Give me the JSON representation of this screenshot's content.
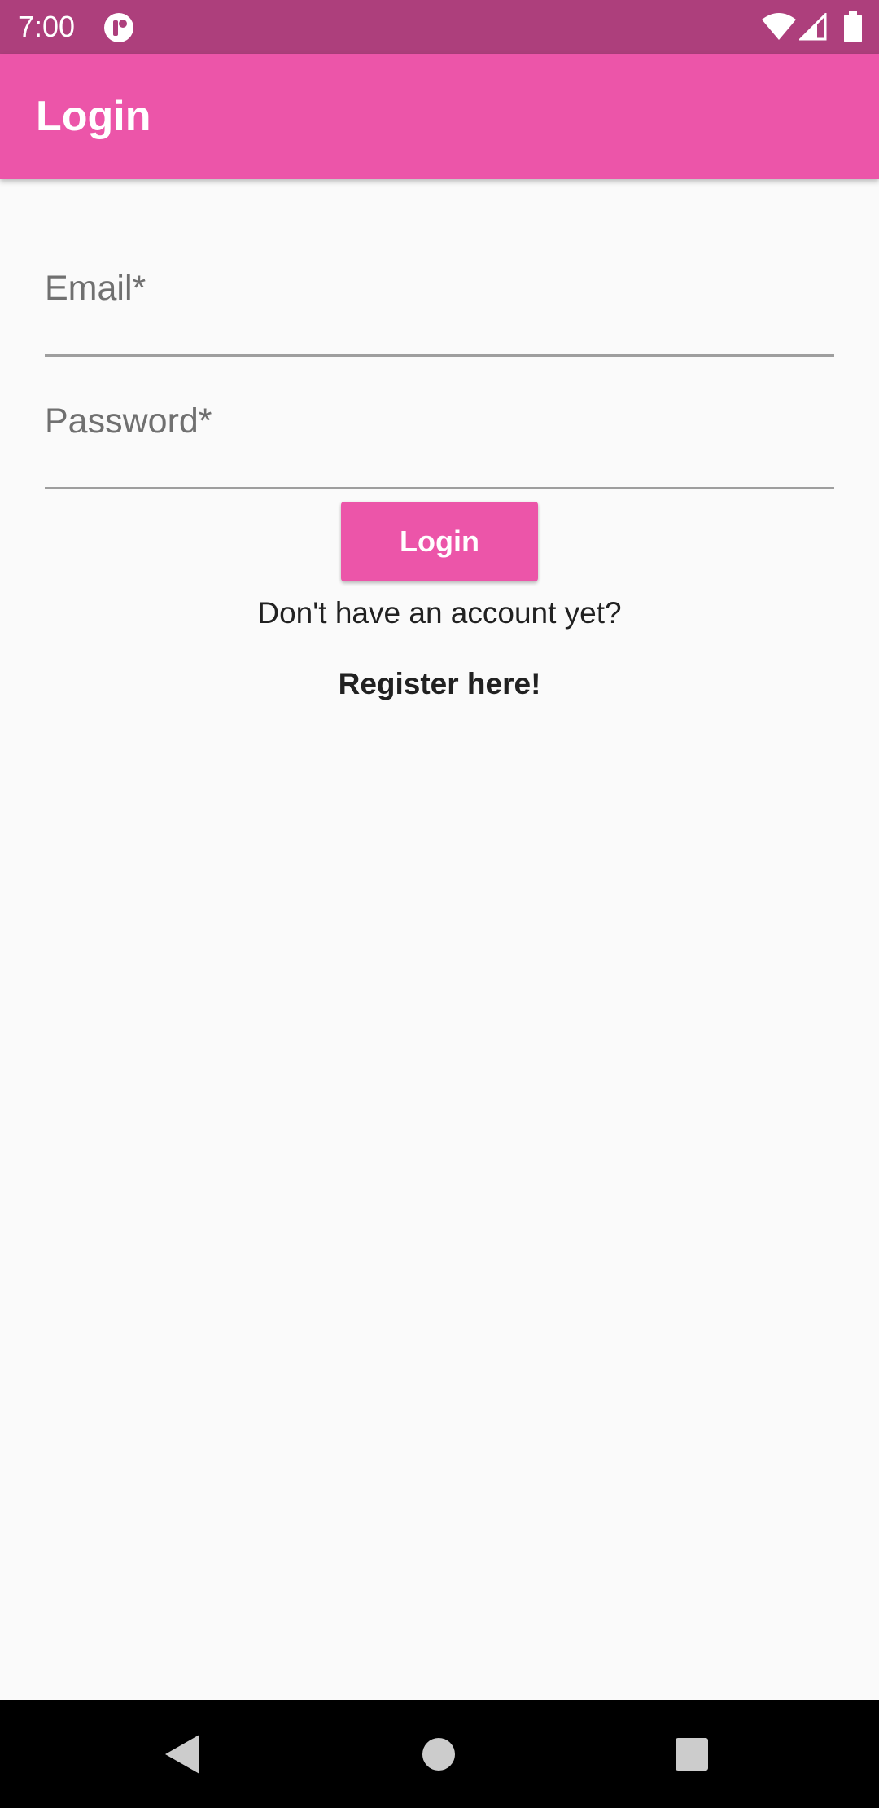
{
  "status_bar": {
    "time": "7:00",
    "icons": [
      "app-notification-icon",
      "wifi-icon",
      "cell-signal-icon",
      "battery-icon"
    ]
  },
  "app_bar": {
    "title": "Login"
  },
  "form": {
    "email_label": "Email*",
    "email_value": "",
    "password_label": "Password*",
    "password_value": "",
    "login_button_label": "Login",
    "no_account_text": "Don't have an account yet?",
    "register_link_label": "Register here!"
  },
  "nav_bar": {
    "icons": [
      "back-icon",
      "home-icon",
      "recents-icon"
    ]
  },
  "colors": {
    "status_bar": "#ad3f7c",
    "primary": "#ec55a9",
    "background": "#fafafa",
    "nav_bar": "#000000"
  }
}
